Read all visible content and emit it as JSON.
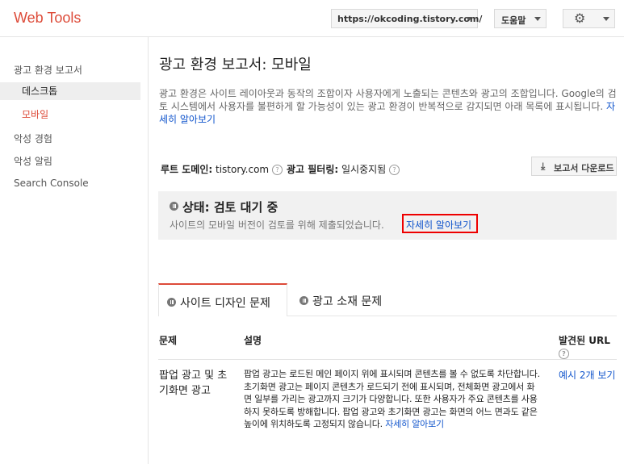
{
  "app": {
    "title": "Web Tools"
  },
  "header": {
    "site": "https://okcoding.tistory.com/",
    "help_label": "도움말",
    "settings_icon": "gear-icon"
  },
  "sidebar": {
    "items": [
      {
        "label": "광고 환경 보고서"
      },
      {
        "label": "데스크톱"
      },
      {
        "label": "모바일"
      },
      {
        "label": "악성 경험"
      },
      {
        "label": "악성 알림"
      },
      {
        "label": "Search Console"
      }
    ]
  },
  "main": {
    "title": "광고 환경 보고서: 모바일",
    "description": "광고 환경은 사이트 레이아웃과 동작의 조합이자 사용자에게 노출되는 콘텐츠와 광고의 조합입니다. Google의 검토 시스템에서 사용자를 불편하게 할 가능성이 있는 광고 환경이 반복적으로 감지되면 아래 목록에 표시됩니다.",
    "description_link": "자세히 알아보기",
    "root_domain_label": "루트 도메인:",
    "root_domain_value": "tistory.com",
    "ad_filter_label": "광고 필터링:",
    "ad_filter_value": "일시중지됨",
    "download_label": "보고서 다운로드"
  },
  "status": {
    "title": "상태: 검토 대기 중",
    "message": "사이트의 모바일 버전이 검토를 위해 제출되었습니다.",
    "link": "자세히 알아보기"
  },
  "tabs": [
    {
      "label": "사이트 디자인 문제",
      "active": true
    },
    {
      "label": "광고 소재 문제",
      "active": false
    }
  ],
  "table": {
    "headers": {
      "issue": "문제",
      "description": "설명",
      "urls": "발견된 URL"
    },
    "rows": [
      {
        "issue": "팝업 광고 및 초기화면 광고",
        "description": "팝업 광고는 로드된 메인 페이지 위에 표시되며 콘텐츠를 볼 수 없도록 차단합니다. 초기화면 광고는 페이지 콘텐츠가 로드되기 전에 표시되며, 전체화면 광고에서 화면 일부를 가리는 광고까지 크기가 다양합니다. 또한 사용자가 주요 콘텐츠를 사용하지 못하도록 방해합니다. 팝업 광고와 초기화면 광고는 화면의 어느 면과도 같은 높이에 위치하도록 고정되지 않습니다.",
        "description_link": "자세히 알아보기",
        "urls_link": "예시 2개 보기"
      }
    ]
  }
}
